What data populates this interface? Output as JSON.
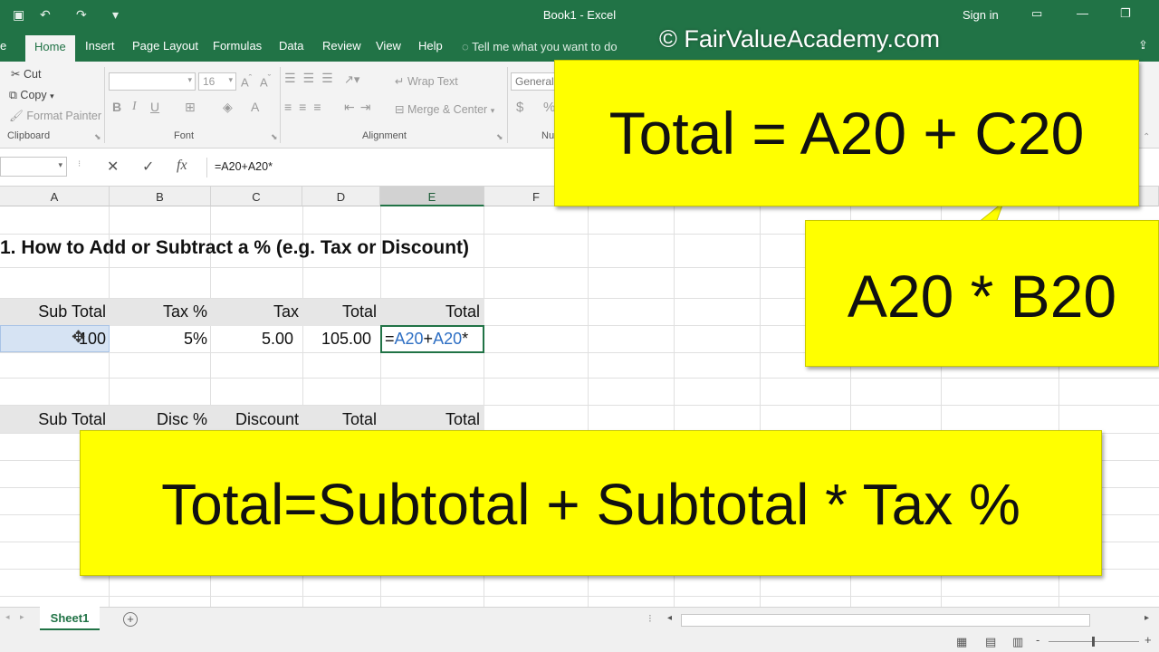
{
  "titlebar": {
    "title": "Book1  -  Excel",
    "signin": "Sign in",
    "undo_icon": "↶",
    "redo_icon": "↷",
    "more_icon": "▾",
    "ribbon_display_icon": "▭",
    "minimize_icon": "—",
    "restore_icon": "❐"
  },
  "tabs": {
    "file": "e",
    "home": "Home",
    "insert": "Insert",
    "page_layout": "Page Layout",
    "formulas": "Formulas",
    "data": "Data",
    "review": "Review",
    "view": "View",
    "help": "Help",
    "tell_me": "Tell me what you want to do"
  },
  "ribbon": {
    "cut": "Cut",
    "copy": "Copy",
    "format_painter": "Format Painter",
    "clipboard_label": "Clipboard",
    "font_size": "16",
    "bold": "B",
    "italic": "I",
    "underline": "U",
    "font_label": "Font",
    "wrap_text": "Wrap Text",
    "merge_center": "Merge & Center",
    "alignment_label": "Alignment",
    "number_format": "General",
    "currency": "$",
    "percent": "%",
    "number_label": "Nu"
  },
  "formula_bar": {
    "cancel": "✕",
    "enter": "✓",
    "fx": "fx",
    "formula": "=A20+A20*"
  },
  "columns": [
    "A",
    "B",
    "C",
    "D",
    "E",
    "F"
  ],
  "sheet": {
    "heading": "1. How to Add or Subtract a % (e.g. Tax or Discount)",
    "table1": {
      "headers": [
        "Sub Total",
        "Tax %",
        "Tax",
        "Total",
        "Total"
      ],
      "row": {
        "subtotal": "100",
        "tax_pct": "5%",
        "tax": "5.00",
        "total": "105.00",
        "edit_eq": "=",
        "edit_ref1": "A20",
        "edit_plus": "+",
        "edit_ref2": "A20",
        "edit_star": "*"
      }
    },
    "table2": {
      "headers": [
        "Sub Total",
        "Disc %",
        "Discount",
        "Total",
        "Total"
      ]
    }
  },
  "sheet_tabs": {
    "active": "Sheet1",
    "add": "+"
  },
  "overlays": {
    "watermark": "© FairValueAcademy.com",
    "callout_top": "Total = A20 + C20",
    "callout_mid": "A20 * B20",
    "callout_bottom": "Total=Subtotal + Subtotal * Tax %"
  },
  "colors": {
    "excel_green": "#217346",
    "callout_yellow": "#ffff00",
    "ref_blue": "#2e6fc4"
  }
}
